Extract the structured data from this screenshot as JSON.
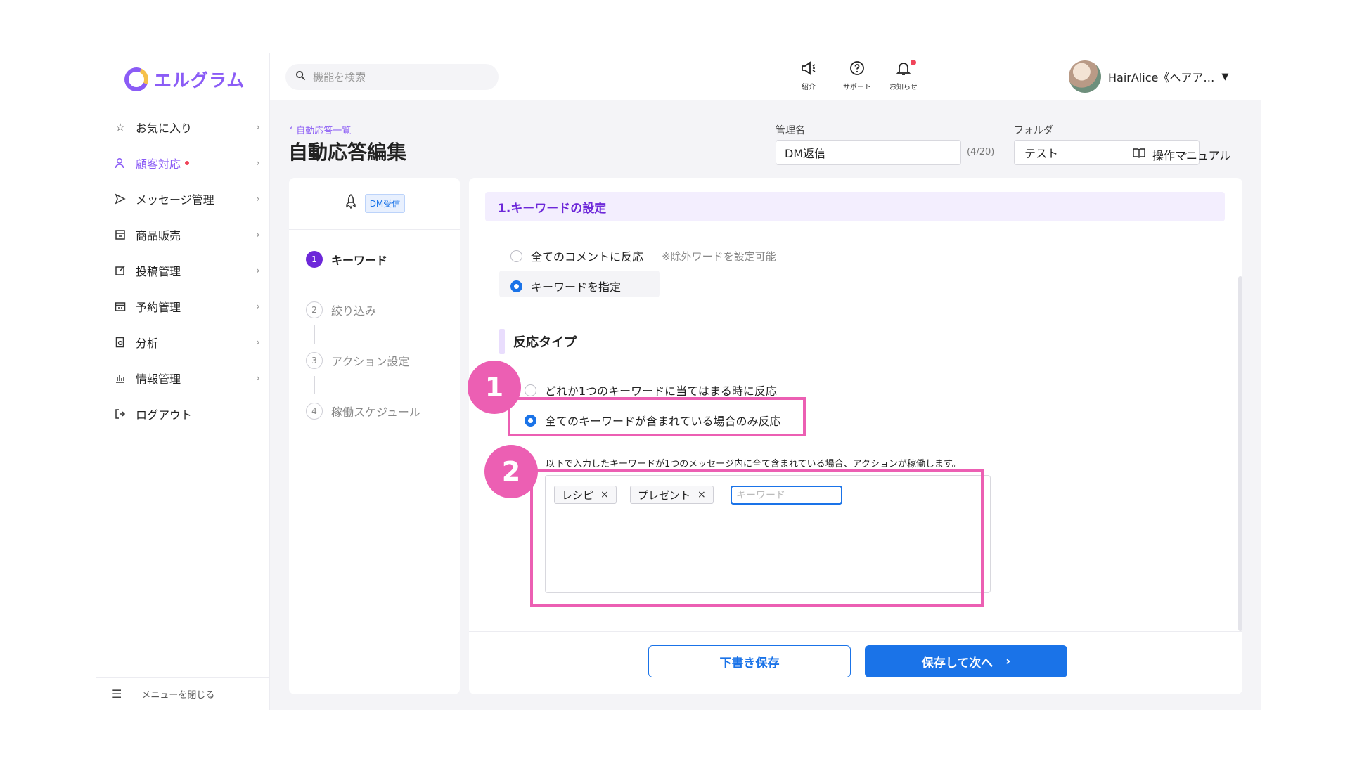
{
  "brand": {
    "name": "エルグラム",
    "accent": "#8b5cf6",
    "primary": "#1a73e8",
    "annotation": "#ec5fb3"
  },
  "sidebar": {
    "items": [
      {
        "label": "お気に入り",
        "icon": "star-icon"
      },
      {
        "label": "顧客対応",
        "icon": "person-icon",
        "active": true,
        "badge_dot": true
      },
      {
        "label": "メッセージ管理",
        "icon": "send-icon"
      },
      {
        "label": "商品販売",
        "icon": "store-icon"
      },
      {
        "label": "投稿管理",
        "icon": "edit-icon"
      },
      {
        "label": "予約管理",
        "icon": "calendar-icon"
      },
      {
        "label": "分析",
        "icon": "report-icon"
      },
      {
        "label": "情報管理",
        "icon": "chart-icon"
      },
      {
        "label": "ログアウト",
        "icon": "logout-icon"
      }
    ],
    "close_label": "メニューを閉じる"
  },
  "header": {
    "search_placeholder": "機能を検索",
    "intro_label": "紹介",
    "support_label": "サポート",
    "notice_label": "お知らせ",
    "user_name": "HairAlice《ヘアア…"
  },
  "page": {
    "breadcrumb": "自動応答一覧",
    "title": "自動応答編集",
    "name_label": "管理名",
    "name_value": "DM返信",
    "name_counter": "(4/20)",
    "folder_label": "フォルダ",
    "folder_value": "テスト",
    "manual_label": "操作マニュアル"
  },
  "steps": {
    "trigger_tag": "DM受信",
    "items": [
      {
        "num": "1",
        "label": "キーワード"
      },
      {
        "num": "2",
        "label": "絞り込み"
      },
      {
        "num": "3",
        "label": "アクション設定"
      },
      {
        "num": "4",
        "label": "稼働スケジュール"
      }
    ]
  },
  "main": {
    "section_title": "1.キーワードの設定",
    "all_comments_label": "全てのコメントに反応",
    "all_comments_note": "※除外ワードを設定可能",
    "specify_label": "キーワードを指定",
    "response_type_title": "反応タイプ",
    "any_match_label": "どれか1つのキーワードに当てはまる時に反応",
    "all_match_label": "全てのキーワードが含まれている場合のみ反応",
    "hint": "以下で入力したキーワードが1つのメッセージ内に全て含まれている場合、アクションが稼働します。",
    "keywords": [
      "レシピ",
      "プレゼント"
    ],
    "keyword_placeholder": "キーワード",
    "draft_button": "下書き保存",
    "next_button": "保存して次へ"
  },
  "annotations": {
    "one": "1",
    "two": "2"
  }
}
